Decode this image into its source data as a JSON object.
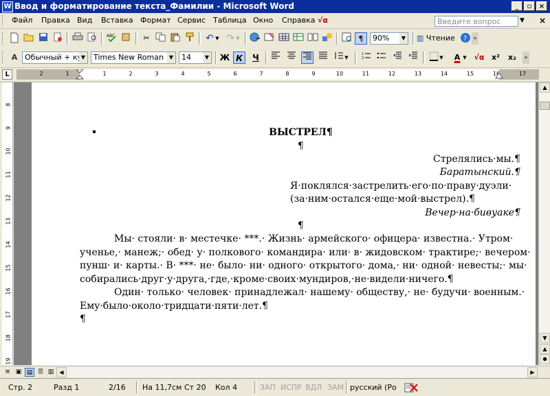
{
  "window": {
    "app_icon": "word-app-icon",
    "title": "Ввод и форматирование текста_Фамилии - Microsoft Word",
    "controls": {
      "minimize": "_",
      "maximize": "▫",
      "close": "×"
    }
  },
  "menu": {
    "items": [
      "Файл",
      "Правка",
      "Вид",
      "Вставка",
      "Формат",
      "Сервис",
      "Таблица",
      "Окно",
      "Справка"
    ],
    "help_glyph": "√α",
    "ask_placeholder": "Введите вопрос",
    "close_doc": "×"
  },
  "toolbar_standard": {
    "zoom": "90%",
    "reading_label": "Чтение",
    "pilcrow": "¶"
  },
  "toolbar_format": {
    "style": "Обычный + кур",
    "font": "Times New Roman",
    "size": "14",
    "bold": "Ж",
    "italic": "К",
    "underline": "Ч",
    "superscript": "x²",
    "subscript": "x₂",
    "font_color_glyph": "A",
    "formula_glyph": "√α"
  },
  "ruler": {
    "tab_selector": "L",
    "numbers": [
      "2",
      "1",
      "1",
      "2",
      "3",
      "4",
      "5",
      "6",
      "7",
      "8",
      "9",
      "10",
      "11",
      "12",
      "13",
      "14",
      "15",
      "16",
      "17"
    ],
    "vertical_numbers": [
      "8",
      "9",
      "10",
      "11",
      "12",
      "13",
      "14",
      "15",
      "16",
      "17",
      "18",
      "19"
    ]
  },
  "document": {
    "title": "ВЫСТРЕЛ¶",
    "empty_para": "¶",
    "epigraph1_line1": "Стрелялись·мы.¶",
    "epigraph1_author": "Баратынский.¶",
    "epigraph2_line1": "Я·поклялся·застрелить·его·по·праву·дуэли·",
    "epigraph2_line2": "(за·ним·остался·еще·мой·выстрел).¶",
    "epigraph2_author": "Вечер·на·бивуаке¶",
    "empty_para2": "¶",
    "p1_lines": [
      "Мы· стояли· в· местечке· ***.· Жизнь· армейского· офицера· известна.· Утром·",
      "ученье,· манеж;· обед· у· полкового· командира· или· в· жидовском· трактире;· вечером·",
      "пунш· и· карты.· В· ***· не· было· ни· одного· открытого· дома,· ни· одной· невесты;· мы·",
      "собирались·друг·у·друга,·где,·кроме·своих·мундиров,·не·видели·ничего.¶"
    ],
    "p2_lines": [
      "Один· только· человек· принадлежал· нашему· обществу,· не· будучи· военным.·",
      "Ему·было·около·тридцати·пяти·лет.¶"
    ],
    "final_para": "¶"
  },
  "status": {
    "page": "Стр. 2",
    "section": "Разд 1",
    "pages": "2/16",
    "position": "На 11,7см",
    "line": "Ст 20",
    "column": "Кол 4",
    "rec": "ЗАП",
    "trk": "ИСПР",
    "ext": "ВДЛ",
    "ovr": "ЗАМ",
    "language": "русский (Ро",
    "spell_icon": "spelling-check-icon"
  }
}
